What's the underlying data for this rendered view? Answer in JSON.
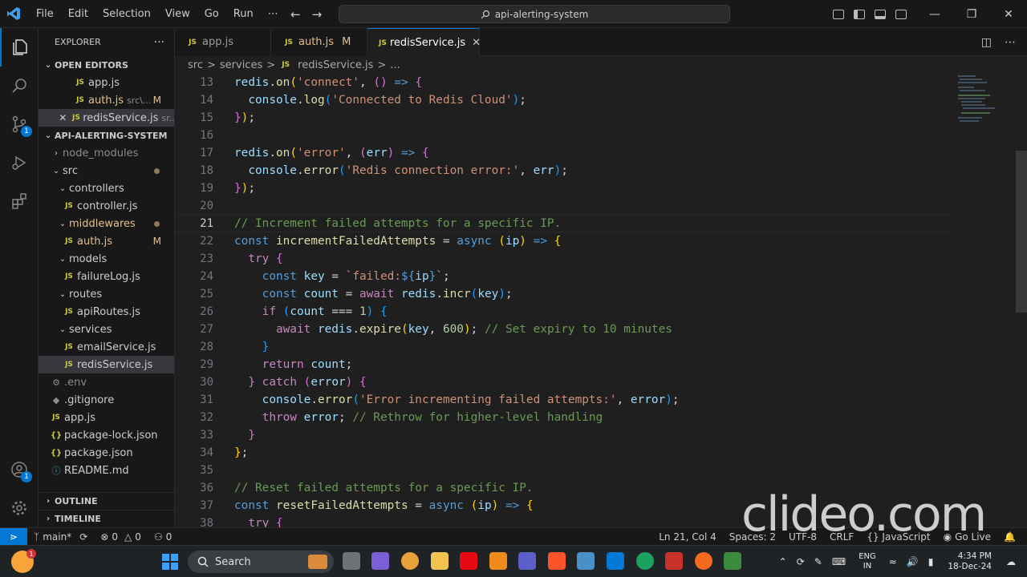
{
  "menu": [
    "File",
    "Edit",
    "Selection",
    "View",
    "Go",
    "Run",
    "⋯"
  ],
  "search": {
    "text": "api-alerting-system"
  },
  "activity": {
    "source_control_badge": "1",
    "accounts_badge": "1"
  },
  "sidebar": {
    "title": "EXPLORER",
    "more": "···",
    "open_editors_title": "OPEN EDITORS",
    "open_editors": [
      {
        "name": "app.js",
        "path": "",
        "flag": ""
      },
      {
        "name": "auth.js",
        "path": "src\\...",
        "flag": "M"
      },
      {
        "name": "redisService.js",
        "path": "sr...",
        "flag": ""
      }
    ],
    "project_title": "API-ALERTING-SYSTEM",
    "tree": {
      "node_modules": "node_modules",
      "src": "src",
      "controllers": "controllers",
      "controller_js": "controller.js",
      "middlewares": "middlewares",
      "auth_js": "auth.js",
      "auth_flag": "M",
      "models": "models",
      "failurelog_js": "failureLog.js",
      "routes": "routes",
      "apiroutes_js": "apiRoutes.js",
      "services": "services",
      "emailservice_js": "emailService.js",
      "redisservice_js": "redisService.js",
      "env": ".env",
      "gitignore": ".gitignore",
      "app_js": "app.js",
      "package_lock": "package-lock.json",
      "package_json": "package.json",
      "readme": "README.md"
    },
    "outline": "OUTLINE",
    "timeline": "TIMELINE"
  },
  "tabs": [
    {
      "label": "app.js",
      "flag": ""
    },
    {
      "label": "auth.js",
      "flag": "M"
    },
    {
      "label": "redisService.js",
      "flag": "✕"
    }
  ],
  "breadcrumb": [
    "src",
    ">",
    "services",
    ">",
    "redisService.js",
    ">",
    "..."
  ],
  "editor": {
    "line_numbers": [
      "13",
      "14",
      "15",
      "16",
      "17",
      "18",
      "19",
      "20",
      "21",
      "22",
      "23",
      "24",
      "25",
      "26",
      "27",
      "28",
      "29",
      "30",
      "31",
      "32",
      "33",
      "34",
      "35",
      "36",
      "37",
      "38"
    ],
    "current_line": "21"
  },
  "status": {
    "branch": "main*",
    "errors": "0",
    "warnings": "0",
    "ports": "0",
    "position": "Ln 21, Col 4",
    "spaces": "Spaces: 2",
    "encoding": "UTF-8",
    "eol": "CRLF",
    "language": "{} JavaScript",
    "golive": "Go Live"
  },
  "watermark": "clideo.com",
  "taskbar": {
    "search_label": "Search",
    "lang_top": "ENG",
    "lang_bottom": "IN",
    "time": "4:34 PM",
    "date": "18-Dec-24",
    "weather_badge": "1"
  }
}
